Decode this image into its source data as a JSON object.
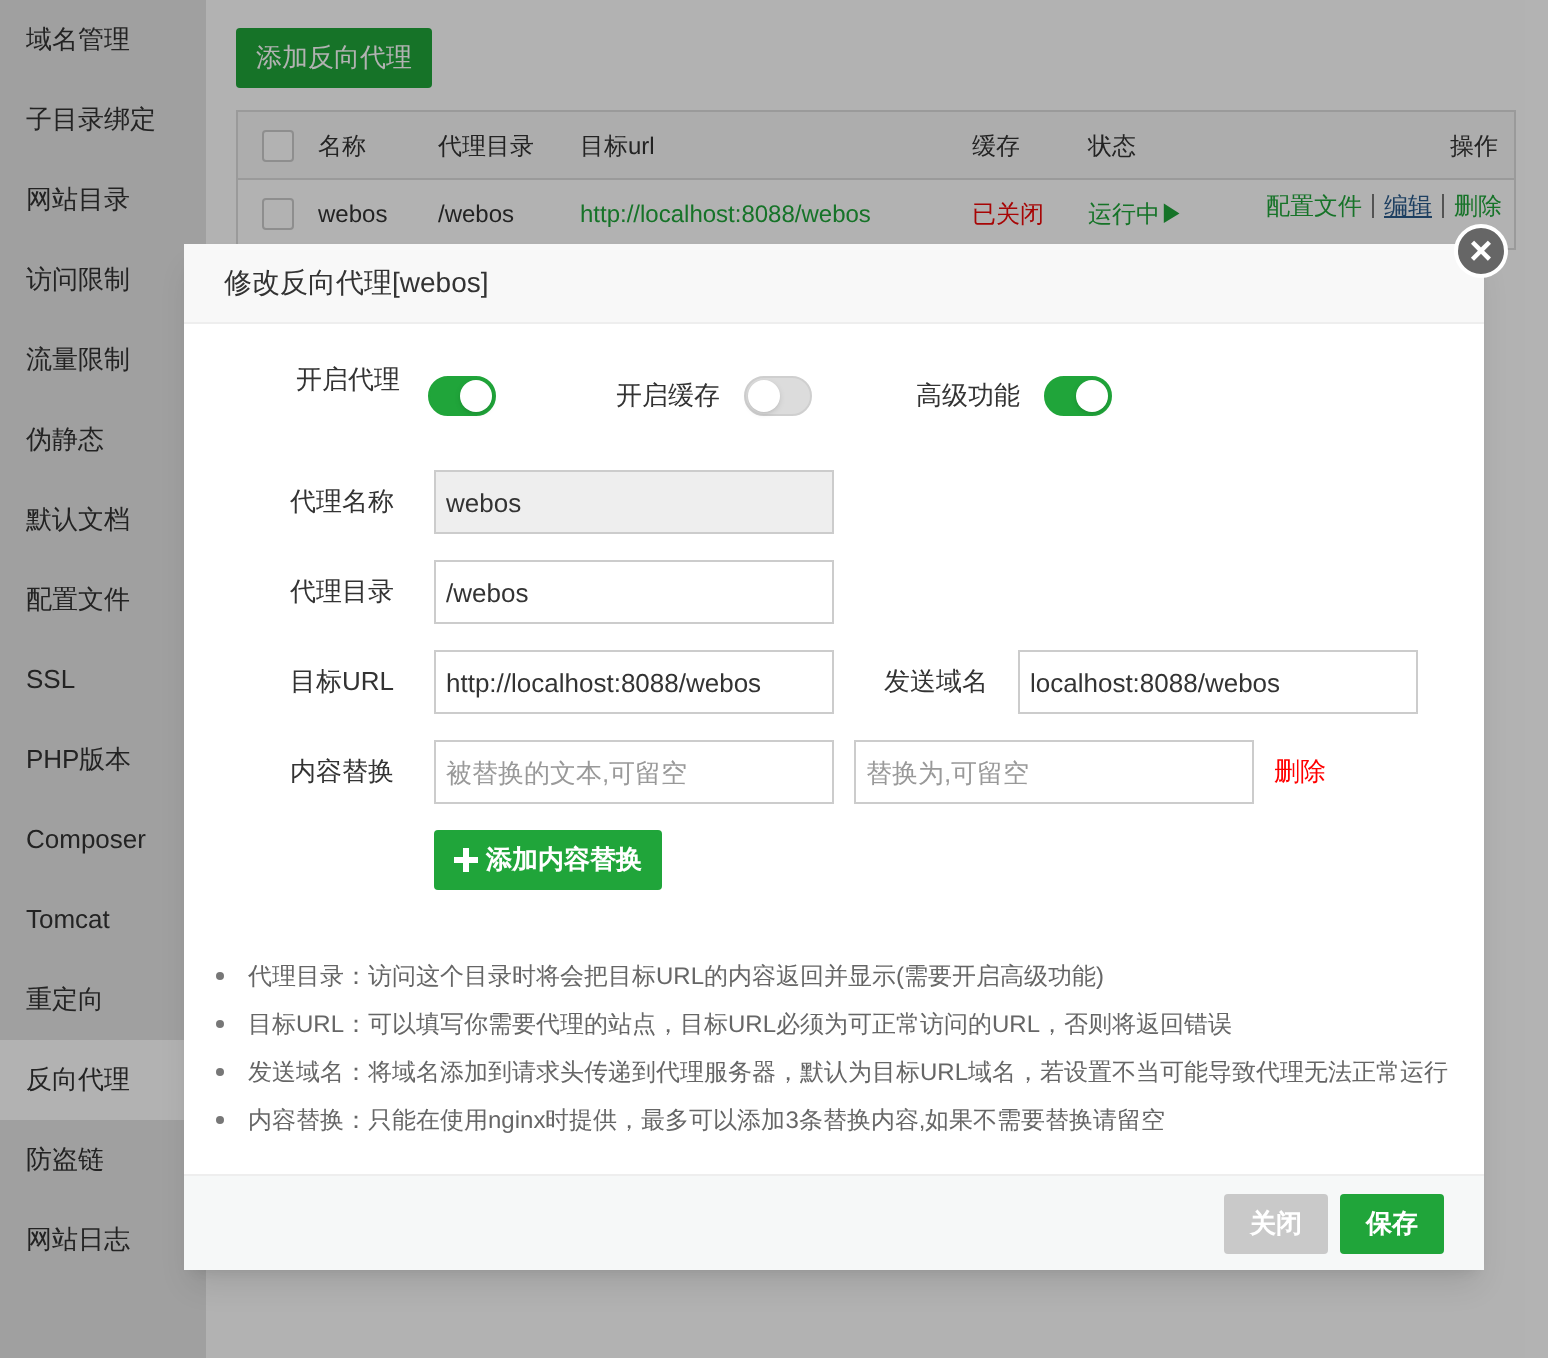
{
  "sidebar": {
    "items": [
      {
        "label": "域名管理",
        "selected": false
      },
      {
        "label": "子目录绑定",
        "selected": false
      },
      {
        "label": "网站目录",
        "selected": false
      },
      {
        "label": "访问限制",
        "selected": false
      },
      {
        "label": "流量限制",
        "selected": false
      },
      {
        "label": "伪静态",
        "selected": false
      },
      {
        "label": "默认文档",
        "selected": false
      },
      {
        "label": "配置文件",
        "selected": false
      },
      {
        "label": "SSL",
        "selected": false
      },
      {
        "label": "PHP版本",
        "selected": false
      },
      {
        "label": "Composer",
        "selected": false
      },
      {
        "label": "Tomcat",
        "selected": false
      },
      {
        "label": "重定向",
        "selected": false
      },
      {
        "label": "反向代理",
        "selected": true
      },
      {
        "label": "防盗链",
        "selected": false
      },
      {
        "label": "网站日志",
        "selected": false
      }
    ]
  },
  "add_button": "添加反向代理",
  "table": {
    "all_checked": false,
    "columns": [
      "名称",
      "代理目录",
      "目标url",
      "缓存",
      "状态",
      "操作"
    ],
    "rows": [
      {
        "checked": false,
        "name": "webos",
        "directory": "/webos",
        "url": "http://localhost:8088/webos",
        "cache": "已关闭",
        "status": "运行中▶",
        "actions": [
          {
            "label": "配置文件",
            "kind": "plain"
          },
          {
            "label": "编辑",
            "kind": "underlined"
          },
          {
            "label": "删除",
            "kind": "plain"
          }
        ]
      }
    ]
  },
  "dialog": {
    "title": "修改反向代理[webos]",
    "close": "×",
    "toggles": [
      {
        "label": "开启代理",
        "on": true
      },
      {
        "label": "开启缓存",
        "on": false
      },
      {
        "label": "高级功能",
        "on": true
      }
    ],
    "fields": [
      {
        "label": "代理名称",
        "inputs": [
          {
            "value": "webos",
            "disabled": true
          }
        ]
      },
      {
        "label": "代理目录",
        "inputs": [
          {
            "value": "/webos",
            "disabled": false
          }
        ]
      },
      {
        "label": "目标URL",
        "inputs": [
          {
            "value": "http://localhost:8088/webos",
            "disabled": false
          }
        ],
        "extra_label": "发送域名",
        "extra_input": {
          "value": "localhost:8088/webos",
          "disabled": false
        }
      },
      {
        "label": "内容替换",
        "inputs": [
          {
            "placeholder": "被替换的文本,可留空",
            "disabled": false
          },
          {
            "placeholder": "替换为,可留空",
            "disabled": false
          }
        ],
        "delete": "删除"
      }
    ],
    "add_replace_button": "添加内容替换",
    "notes": [
      "代理目录：访问这个目录时将会把目标URL的内容返回并显示(需要开启高级功能)",
      "目标URL：可以填写你需要代理的站点，目标URL必须为可正常访问的URL，否则将返回错误",
      "发送域名：将域名添加到请求头传递到代理服务器，默认为目标URL域名，若设置不当可能导致代理无法正常运行",
      "内容替换：只能在使用nginx时提供，最多可以添加3条替换内容,如果不需要替换请留空"
    ],
    "buttons": [
      {
        "label": "关闭",
        "kind": "secondary"
      },
      {
        "label": "保存",
        "kind": "primary"
      }
    ]
  }
}
